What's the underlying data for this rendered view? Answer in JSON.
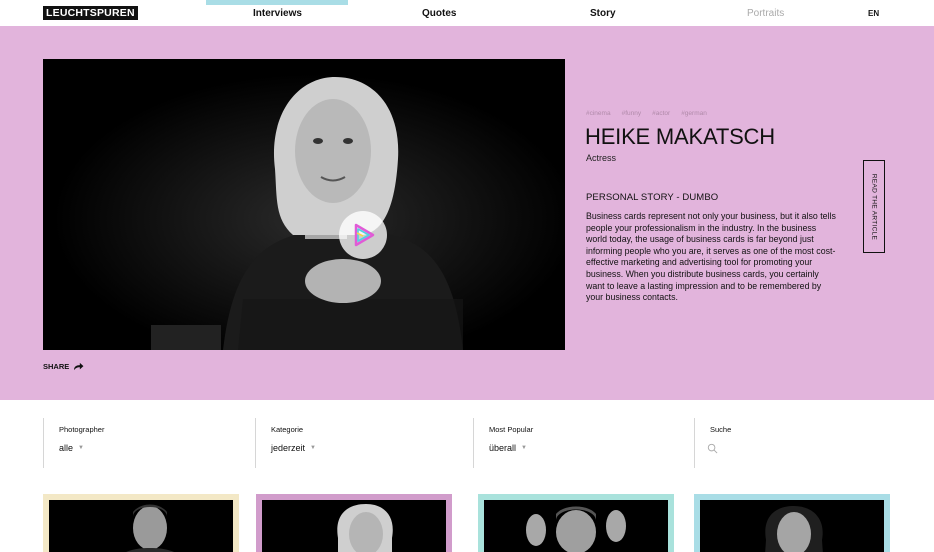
{
  "nav": {
    "logo": "LEUCHTSPUREN",
    "items": [
      {
        "label": "Interviews",
        "active": true
      },
      {
        "label": "Quotes",
        "active": false
      },
      {
        "label": "Story",
        "active": false
      },
      {
        "label": "Portraits",
        "active": false
      }
    ],
    "language": "EN"
  },
  "hero": {
    "background": "#e2b4dc",
    "tags": [
      "#cinema",
      "#funny",
      "#actor",
      "#german"
    ],
    "name": "HEIKE MAKATSCH",
    "role": "Actress",
    "story_title": "PERSONAL STORY - DUMBO",
    "story_body": "Business cards represent not only your business, but it also tells people your professionalism in the industry. In the business world today, the usage of business cards is far beyond just informing people who you are, it serves as one of the most cost-effective marketing and advertising tool for promoting your business. When you distribute business cards, you certainly want to leave a lasting impression and to be remembered by your business contacts.",
    "read_article": "READ THE ARTICLE",
    "share": "SHARE"
  },
  "filters": {
    "photographer": {
      "label": "Photographer",
      "value": "alle"
    },
    "category": {
      "label": "Kategorie",
      "value": "jederzeit"
    },
    "popular": {
      "label": "Most Popular",
      "value": "überall"
    },
    "search": {
      "label": "Suche",
      "placeholder": ""
    }
  },
  "cards": [
    {
      "frame_color": "#f3e8c6"
    },
    {
      "frame_color": "#d19ccb"
    },
    {
      "frame_color": "#a9e2dc"
    },
    {
      "frame_color": "#a9dde6"
    }
  ],
  "colors": {
    "accent_nav": "#a9dde6",
    "hero_bg": "#e2b4dc"
  }
}
